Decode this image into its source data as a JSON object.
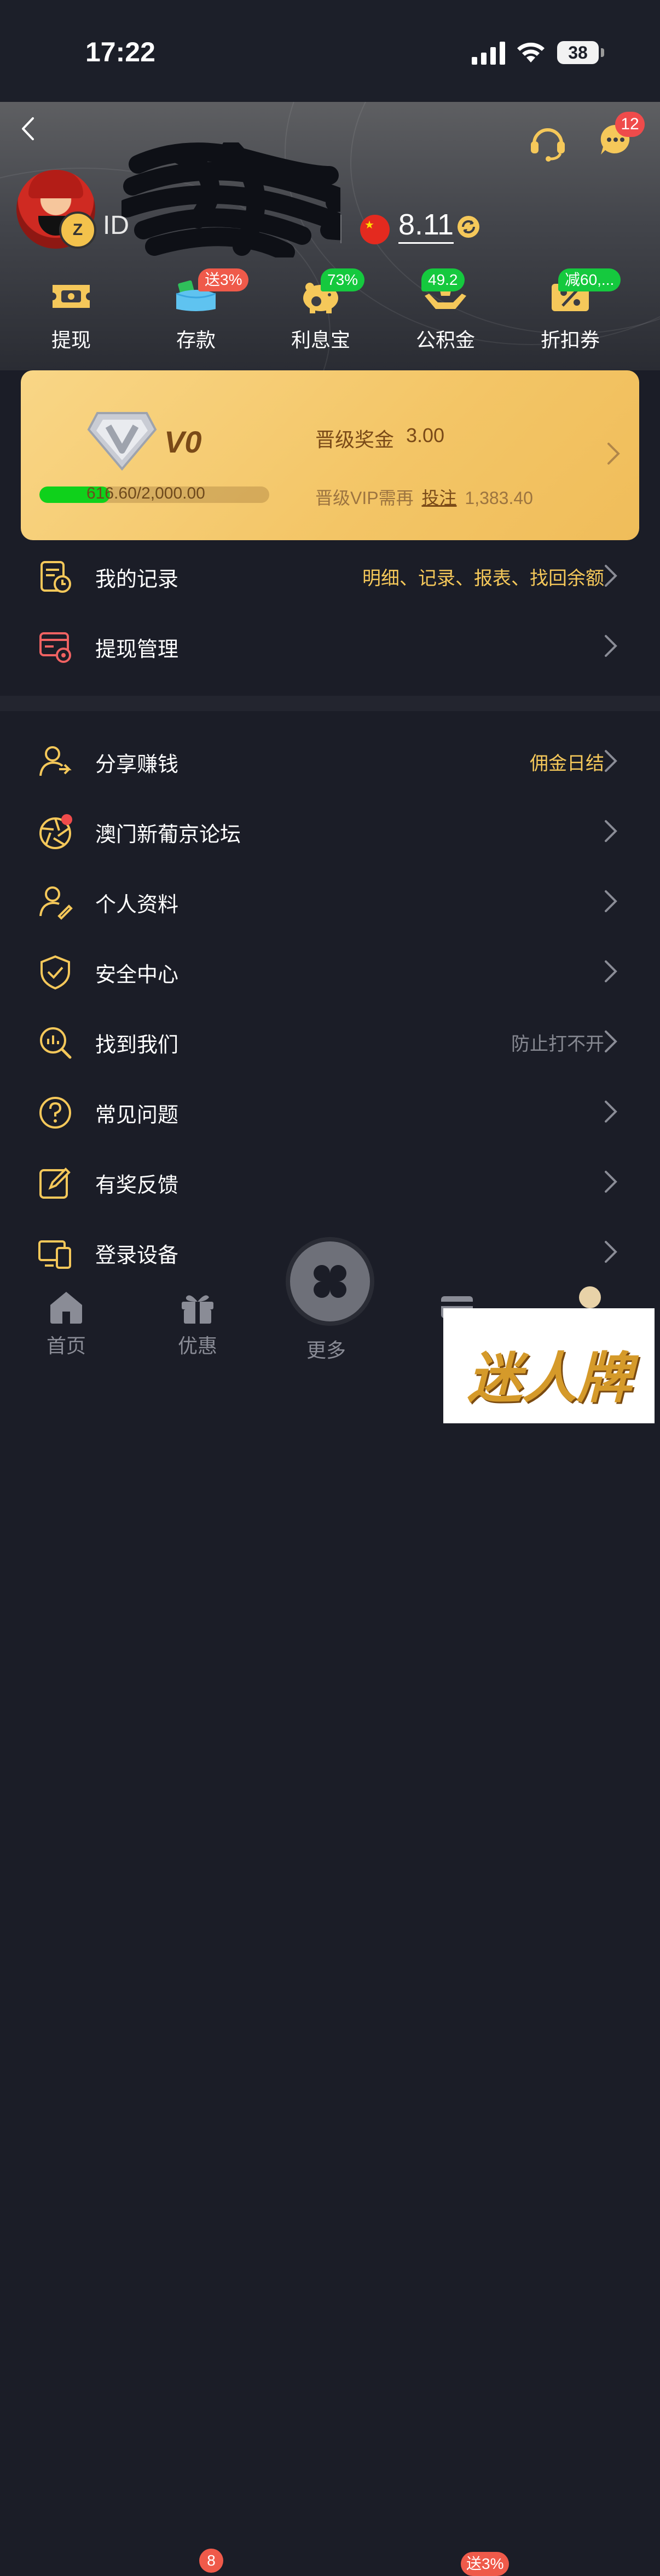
{
  "status_bar": {
    "time": "17:22",
    "battery": "38"
  },
  "header": {
    "message_badge": "12",
    "user_id_prefix": "ID",
    "balance": "8.11"
  },
  "quick_actions": [
    {
      "label": "提现",
      "icon": "withdraw-ticket-icon",
      "badge": ""
    },
    {
      "label": "存款",
      "icon": "deposit-wallet-icon",
      "badge": "送3%"
    },
    {
      "label": "利息宝",
      "icon": "piggy-bank-icon",
      "badge": "73%"
    },
    {
      "label": "公积金",
      "icon": "fund-hands-icon",
      "badge": "49.2"
    },
    {
      "label": "折扣券",
      "icon": "discount-coupon-icon",
      "badge": "减60,..."
    }
  ],
  "vip": {
    "level": "V0",
    "progress_text": "616.60/2,000.00",
    "progress_fraction": 0.3083,
    "bonus_label": "晋级奖金",
    "bonus_value": "3.00",
    "need_prefix": "晋级VIP需再",
    "bet_link": "投注",
    "need_amount": "1,383.40"
  },
  "menu_group_1": [
    {
      "label": "我的记录",
      "note": "明细、记录、报表、找回余额"
    },
    {
      "label": "提现管理",
      "note": ""
    }
  ],
  "menu_group_2": [
    {
      "label": "分享赚钱",
      "note": "佣金日结"
    },
    {
      "label": "澳门新葡京论坛",
      "note": ""
    },
    {
      "label": "个人资料",
      "note": ""
    },
    {
      "label": "安全中心",
      "note": ""
    },
    {
      "label": "找到我们",
      "note": "防止打不开"
    },
    {
      "label": "常见问题",
      "note": ""
    },
    {
      "label": "有奖反馈",
      "note": ""
    },
    {
      "label": "登录设备",
      "note": ""
    }
  ],
  "tabbar": {
    "home": "首页",
    "promo": "优惠",
    "promo_badge": "8",
    "more": "更多",
    "deposit_badge": "送3%"
  },
  "watermark": "迷人牌",
  "colors": {
    "accent_gold": "#f5c85a",
    "badge_red": "#ef5a4a",
    "badge_green": "#15c93e",
    "progress_green": "#0fd11b"
  }
}
